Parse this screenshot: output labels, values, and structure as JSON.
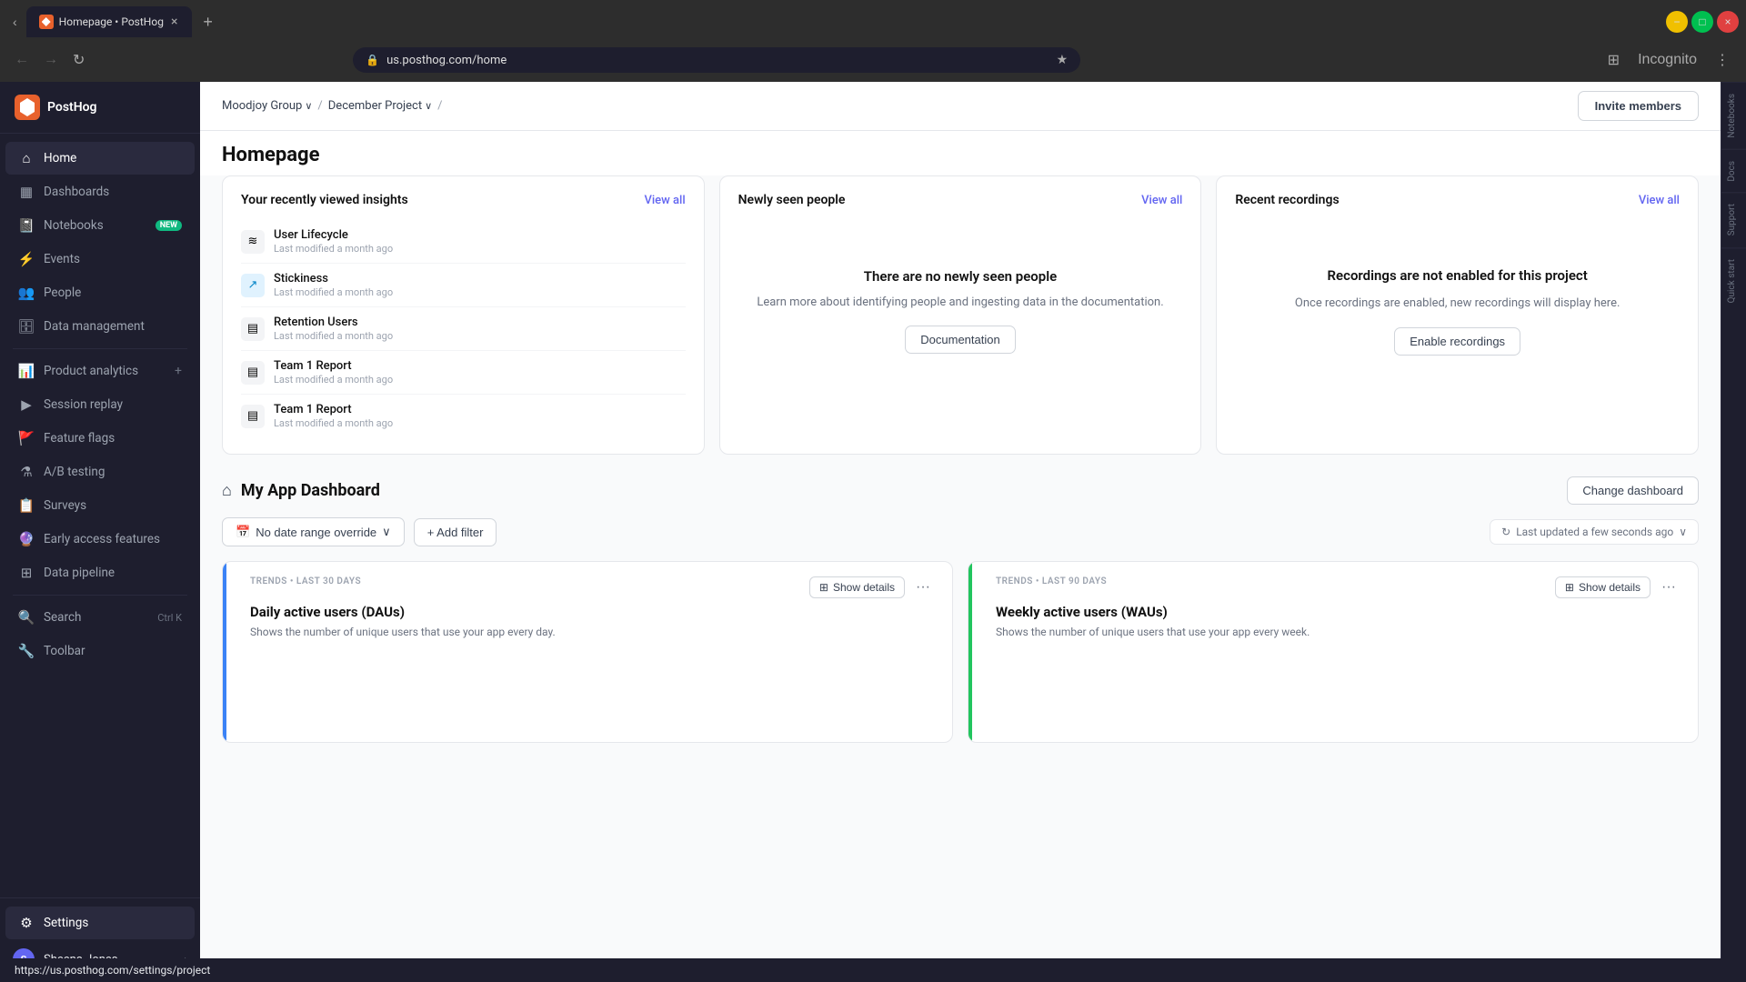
{
  "browser": {
    "tab_title": "Homepage • PostHog",
    "url": "us.posthog.com/home",
    "tab_close_label": "×",
    "tab_new_label": "+",
    "nav_back": "←",
    "nav_forward": "→",
    "nav_refresh": "↻",
    "star_icon": "★",
    "profile_icon": "👤",
    "incognito_label": "Incognito"
  },
  "sidebar": {
    "logo_label": "PostHog",
    "nav_items": [
      {
        "id": "home",
        "label": "Home",
        "icon": "⌂",
        "active": true
      },
      {
        "id": "dashboards",
        "label": "Dashboards",
        "icon": "▦"
      },
      {
        "id": "notebooks",
        "label": "Notebooks",
        "icon": "📓",
        "badge": "NEW"
      },
      {
        "id": "events",
        "label": "Events",
        "icon": "⚡"
      },
      {
        "id": "people",
        "label": "People",
        "icon": "👥"
      },
      {
        "id": "data-management",
        "label": "Data management",
        "icon": "🗄"
      },
      {
        "id": "product-analytics",
        "label": "Product analytics",
        "icon": "📊",
        "add": true
      },
      {
        "id": "session-replay",
        "label": "Session replay",
        "icon": "▶"
      },
      {
        "id": "feature-flags",
        "label": "Feature flags",
        "icon": "🚩"
      },
      {
        "id": "ab-testing",
        "label": "A/B testing",
        "icon": "⚗"
      },
      {
        "id": "surveys",
        "label": "Surveys",
        "icon": "📋"
      },
      {
        "id": "early-access",
        "label": "Early access features",
        "icon": "🔮"
      },
      {
        "id": "data-pipeline",
        "label": "Data pipeline",
        "icon": "⊞"
      },
      {
        "id": "search",
        "label": "Search",
        "icon": "🔍",
        "shortcut": "Ctrl K"
      },
      {
        "id": "toolbar",
        "label": "Toolbar",
        "icon": "🔧"
      },
      {
        "id": "settings",
        "label": "Settings",
        "icon": "⚙",
        "active_bottom": true
      }
    ],
    "user": {
      "name": "Sheena Jones",
      "initials": "S",
      "chevron": "›"
    }
  },
  "right_panels": [
    {
      "id": "notebooks",
      "label": "Notebooks"
    },
    {
      "id": "docs",
      "label": "Docs"
    },
    {
      "id": "support",
      "label": "Support"
    },
    {
      "id": "quick-start",
      "label": "Quick start"
    }
  ],
  "header": {
    "breadcrumb": [
      {
        "label": "Moodjoy Group",
        "chevron": "∨"
      },
      {
        "sep": "/"
      },
      {
        "label": "December Project",
        "chevron": "∨"
      },
      {
        "sep": "/"
      }
    ],
    "page_title": "Homepage",
    "invite_button": "Invite members"
  },
  "insights_card": {
    "title": "Your recently viewed insights",
    "view_all": "View all",
    "items": [
      {
        "name": "User Lifecycle",
        "date": "Last modified a month ago",
        "icon": "≋"
      },
      {
        "name": "Stickiness",
        "date": "Last modified a month ago",
        "icon": "↗"
      },
      {
        "name": "Retention Users",
        "date": "Last modified a month ago",
        "icon": "▤"
      },
      {
        "name": "Team 1 Report",
        "date": "Last modified a month ago",
        "icon": "▤"
      },
      {
        "name": "Team 1 Report",
        "date": "Last modified a month ago",
        "icon": "▤"
      }
    ]
  },
  "people_card": {
    "title": "Newly seen people",
    "view_all": "View all",
    "empty_title": "There are no newly seen people",
    "empty_desc": "Learn more about identifying people and ingesting data in the documentation.",
    "button_label": "Documentation"
  },
  "recordings_card": {
    "title": "Recent recordings",
    "view_all": "View all",
    "recording_title": "Recordings are not enabled for this project",
    "recording_desc": "Once recordings are enabled, new recordings will display here.",
    "button_label": "Enable recordings"
  },
  "dashboard": {
    "icon": "⌂",
    "title": "My App Dashboard",
    "change_btn": "Change dashboard",
    "filter_date": "No date range override",
    "filter_add": "+ Add filter",
    "last_updated": "Last updated a few seconds ago",
    "cards": [
      {
        "accent": "blue",
        "meta": "TRENDS • LAST 30 DAYS",
        "show_details": "Show details",
        "title": "Daily active users (DAUs)",
        "desc": "Shows the number of unique users that use your app every day."
      },
      {
        "accent": "green",
        "meta": "TRENDS • LAST 90 DAYS",
        "show_details": "Show details",
        "title": "Weekly active users (WAUs)",
        "desc": "Shows the number of unique users that use your app every week."
      }
    ]
  },
  "tooltip": {
    "url": "https://us.posthog.com/settings/project"
  }
}
